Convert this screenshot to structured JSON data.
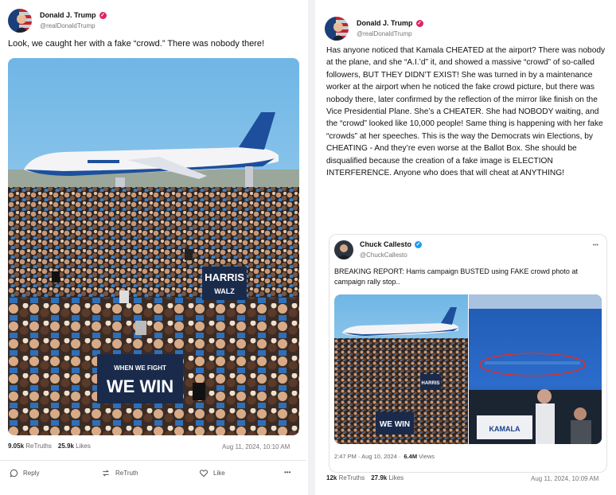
{
  "left_post": {
    "author_name": "Donald J. Trump",
    "handle": "@realDonaldTrump",
    "text": "Look, we caught her with a fake “crowd.” There was nobody there!",
    "sign_harris": "HARRIS",
    "sign_walz": "WALZ",
    "sign_fight": "WHEN WE FIGHT",
    "sign_win": "WE WIN",
    "retruths_count": "9.05k",
    "retruths_label": "ReTruths",
    "likes_count": "25.9k",
    "likes_label": "Likes",
    "date": "Aug 11, 2024, 10:10 AM",
    "reply_label": "Reply",
    "retruth_label": "ReTruth",
    "like_label": "Like",
    "more_label": "•••"
  },
  "right_post": {
    "author_name": "Donald J. Trump",
    "handle": "@realDonaldTrump",
    "text": "Has anyone noticed that Kamala CHEATED at the airport? There was nobody at the plane, and she “A.I.’d” it, and showed a massive “crowd” of so-called followers, BUT THEY DIDN’T EXIST! She was turned in by a maintenance worker at the airport when he noticed the fake crowd picture, but there was nobody there, later confirmed by the reflection of the mirror like finish on the Vice Presidential Plane. She’s a CHEATER. She had NOBODY waiting, and the “crowd” looked like 10,000 people! Same thing is happening with her fake “crowds” at her speeches. This is the way the Democrats win Elections, by CHEATING - And they’re even worse at the Ballot Box. She should be disqualified because the creation of a fake image is ELECTION INTERFERENCE. Anyone who does that will cheat at ANYTHING!",
    "retruths_count": "12k",
    "retruths_label": "ReTruths",
    "likes_count": "27.9k",
    "likes_label": "Likes",
    "date": "Aug 11, 2024, 10:09 AM"
  },
  "quoted_post": {
    "author_name": "Chuck Callesto",
    "handle": "@ChuckCallesto",
    "more_label": "•••",
    "text": "BREAKING REPORT: Harris campaign BUSTED using FAKE crowd photo at campaign rally stop..",
    "sign_harris": "HARRIS",
    "sign_fight": "WE WIN",
    "sign_kamala": "KAMALA",
    "time": "2:47 PM · Aug 10, 2024 ·",
    "views_count": "6.4M",
    "views_label": "Views"
  },
  "colors": {
    "verified_truth": "#e0245e",
    "verified_x": "#1d9bf0",
    "sky": "#8cc7ea",
    "plane_blue": "#1d4f9c",
    "sign_navy": "#1a2a4a"
  }
}
